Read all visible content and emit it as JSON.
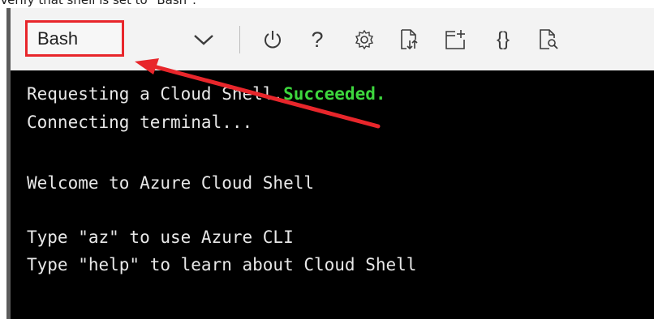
{
  "caption": "Verify that shell is set to \"Bash\".",
  "toolbar": {
    "shell_selector": "Bash",
    "icons": [
      "chevron-down-icon",
      "power-icon",
      "help-icon",
      "settings-icon",
      "upload-download-icon",
      "new-session-icon",
      "braces-icon",
      "preview-icon"
    ],
    "help_glyph": "?",
    "braces_glyph": "{}"
  },
  "terminal": {
    "line1_prefix": "Requesting a Cloud Shell.",
    "line1_status": "Succeeded.",
    "line2": "Connecting terminal...",
    "line3": "Welcome to Azure Cloud Shell",
    "line4": "Type \"az\" to use Azure CLI",
    "line5": "Type \"help\" to learn about Cloud Shell"
  },
  "colors": {
    "highlight": "#e8262b",
    "terminal_bg": "#000000",
    "success": "#3dd63d"
  }
}
